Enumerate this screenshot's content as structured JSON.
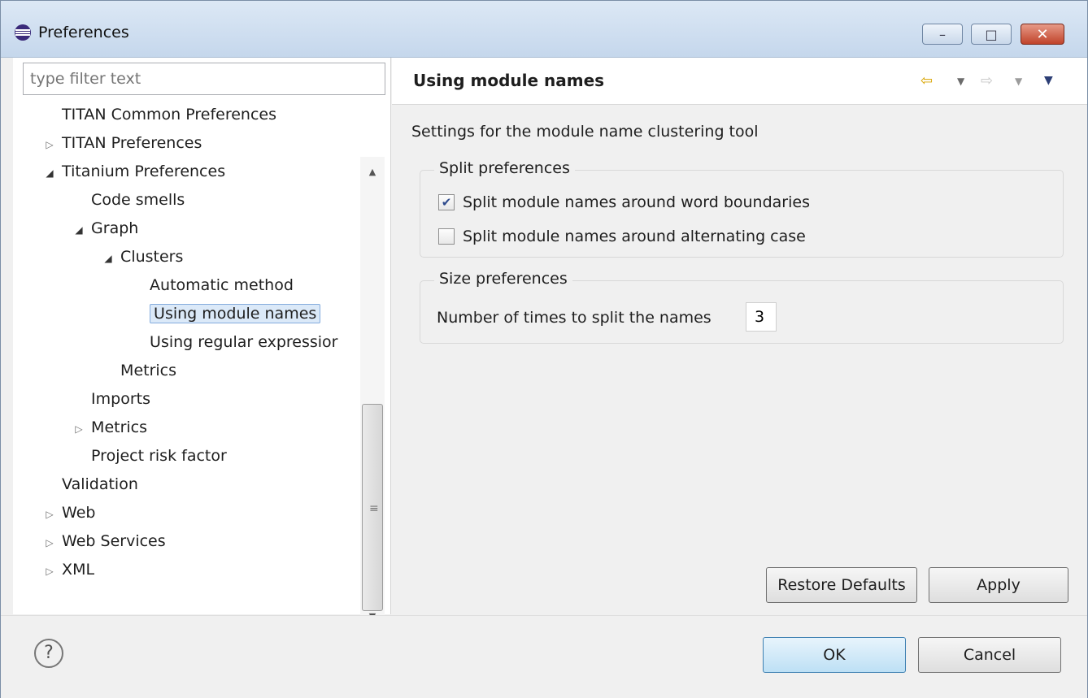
{
  "window": {
    "title": "Preferences",
    "min_glyph": "–",
    "max_glyph": "□",
    "close_glyph": "✕"
  },
  "left": {
    "filter_placeholder": "type filter text",
    "tree": [
      {
        "label": "TITAN Common Preferences",
        "arrow": "",
        "level": 0
      },
      {
        "label": "TITAN Preferences",
        "arrow": "▷",
        "level": 0
      },
      {
        "label": "Titanium Preferences",
        "arrow": "◢",
        "level": 0
      },
      {
        "label": "Code smells",
        "arrow": "",
        "level": 1
      },
      {
        "label": "Graph",
        "arrow": "◢",
        "level": 1
      },
      {
        "label": "Clusters",
        "arrow": "◢",
        "level": 2
      },
      {
        "label": "Automatic method",
        "arrow": "",
        "level": 3
      },
      {
        "label": "Using module names",
        "arrow": "",
        "level": 3,
        "selected": true
      },
      {
        "label": "Using regular expressior",
        "arrow": "",
        "level": 3
      },
      {
        "label": "Metrics",
        "arrow": "",
        "level": 2
      },
      {
        "label": "Imports",
        "arrow": "",
        "level": 1
      },
      {
        "label": "Metrics",
        "arrow": "▷",
        "level": 1
      },
      {
        "label": "Project risk factor",
        "arrow": "",
        "level": 1
      },
      {
        "label": "Validation",
        "arrow": "",
        "level": 0
      },
      {
        "label": "Web",
        "arrow": "▷",
        "level": 0
      },
      {
        "label": "Web Services",
        "arrow": "▷",
        "level": 0
      },
      {
        "label": "XML",
        "arrow": "▷",
        "level": 0
      }
    ]
  },
  "right": {
    "title": "Using module names",
    "description": "Settings for the module name clustering tool",
    "split_group": {
      "legend": "Split preferences",
      "option_word": {
        "label": "Split module names around word boundaries",
        "checked": true
      },
      "option_case": {
        "label": "Split module names around alternating case",
        "checked": false
      }
    },
    "size_group": {
      "legend": "Size preferences",
      "label": "Number of times to split the names",
      "value": "3"
    },
    "restore_label": "Restore Defaults",
    "apply_label": "Apply"
  },
  "footer": {
    "help_glyph": "?",
    "ok_label": "OK",
    "cancel_label": "Cancel"
  }
}
